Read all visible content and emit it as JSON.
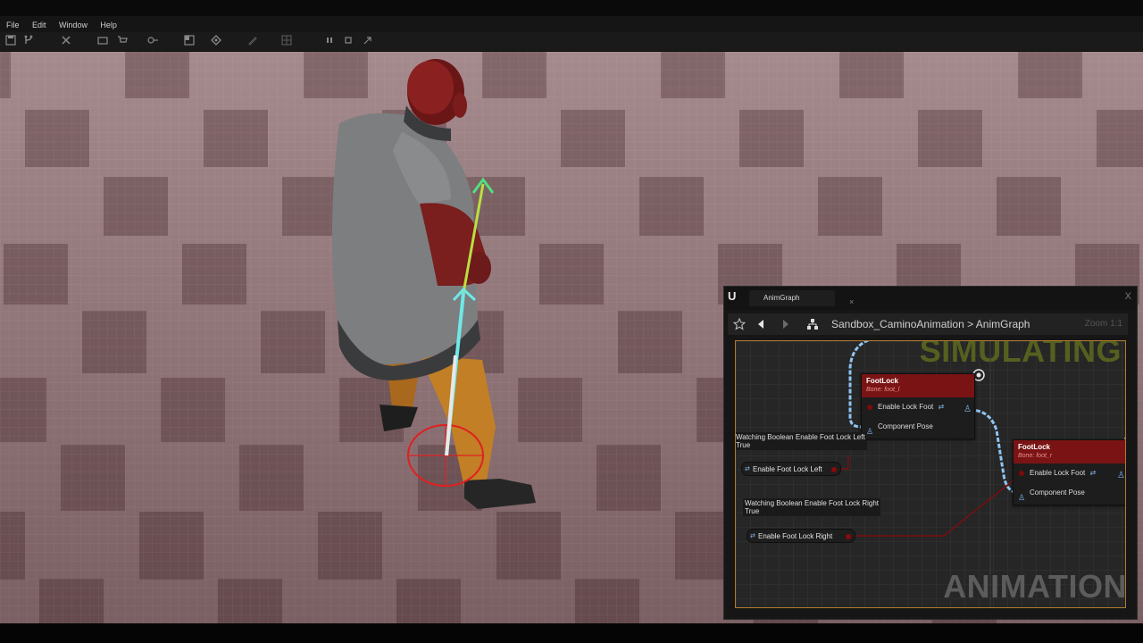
{
  "menu": {
    "items": [
      "File",
      "Edit",
      "Window",
      "Help"
    ]
  },
  "panel": {
    "tab_label": "AnimGraph",
    "tab_close": "×",
    "window_close": "X",
    "breadcrumb": "Sandbox_CaminoAnimation > AnimGraph",
    "zoom": "Zoom 1:1",
    "watermark_simulating": "SIMULATING",
    "watermark_animation": "ANIMATION"
  },
  "graph": {
    "nodes": [
      {
        "title": "FootLock",
        "subtitle": "Bone: foot_l",
        "pin_in": "Enable Lock Foot",
        "pin_pose": "Component Pose"
      },
      {
        "title": "FootLock",
        "subtitle": "Bone: foot_r",
        "pin_in": "Enable Lock Foot",
        "pin_pose": "Component Pose"
      }
    ],
    "comments": [
      {
        "line1": "Watching Boolean Enable Foot Lock Left",
        "line2": "True"
      },
      {
        "line1": "Watching Boolean Enable Foot Lock Right",
        "line2": "True"
      }
    ],
    "variables": [
      "Enable Foot Lock Left",
      "Enable Foot Lock Right"
    ]
  },
  "colors": {
    "node_header": "#7a1414",
    "bool_pin": "#8b0a0a",
    "pose_wire": "#8fc4f2",
    "highlight_border": "#b07a30"
  }
}
